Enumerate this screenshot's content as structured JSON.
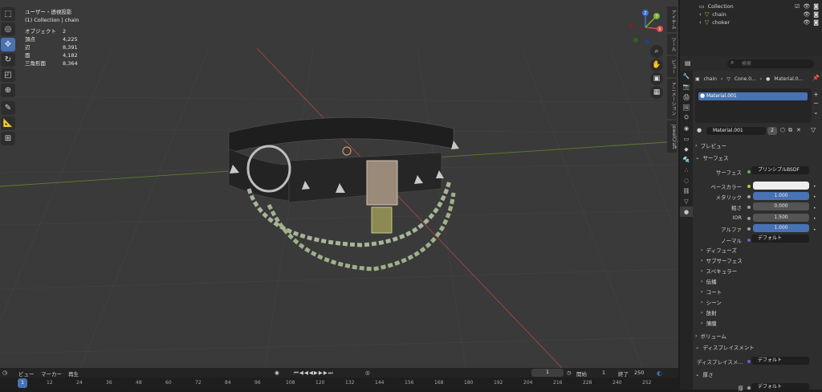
{
  "viewport": {
    "stats_header": "ユーザー・透視投影",
    "stats_sub": "(1) Collection | chain",
    "stats": [
      {
        "label": "オブジェクト",
        "value": "2"
      },
      {
        "label": "頂点",
        "value": "4,225"
      },
      {
        "label": "辺",
        "value": "8,391"
      },
      {
        "label": "面",
        "value": "4,182"
      },
      {
        "label": "三角形面",
        "value": "8,364"
      }
    ],
    "gizmo_axes": {
      "x": "X",
      "y": "Y",
      "z": "Z"
    },
    "side_tabs": [
      "アイテム",
      "ツール",
      "ビュー",
      "アニメーション",
      "JewelCraft"
    ]
  },
  "outliner": {
    "collection": "Collection",
    "items": [
      "chain",
      "choker"
    ]
  },
  "properties": {
    "search_placeholder": "検索",
    "breadcrumb": [
      "chain",
      "Cone.0...",
      "Material.0..."
    ],
    "slot": "Material.001",
    "material_name": "Material.001",
    "material_users": "2",
    "sections": {
      "preview": "プレビュー",
      "surface": "サーフェス",
      "volume": "ボリューム",
      "displacement": "ディスプレイスメント",
      "thickness": "厚さ"
    },
    "surface_label": "サーフェス",
    "surface_value": "プリンシプルBSDF",
    "fields": [
      {
        "label": "ベースカラー",
        "value": ""
      },
      {
        "label": "メタリック",
        "value": "1.000"
      },
      {
        "label": "粗さ",
        "value": "0.000"
      },
      {
        "label": "IOR",
        "value": "1.500"
      },
      {
        "label": "アルファ",
        "value": "1.000"
      },
      {
        "label": "ノーマル",
        "value": "デフォルト"
      }
    ],
    "subsections": [
      "ディフューズ",
      "サブサーフェス",
      "スペキュラー",
      "伝播",
      "コート",
      "シーン",
      "放射",
      "薄膜"
    ],
    "displacement_label": "ディスプレイスメ...",
    "displacement_value": "デフォルト",
    "thickness_value": "デフォルト",
    "thickness_label": "厚"
  },
  "timeline": {
    "menus": [
      "ビュー",
      "マーカー",
      "再生"
    ],
    "current_frame": "1",
    "start_label": "開始",
    "start_value": "1",
    "end_label": "終了",
    "end_value": "250",
    "ruler_frame": "1",
    "ticks": [
      "12",
      "24",
      "36",
      "48",
      "60",
      "72",
      "84",
      "96",
      "108",
      "120",
      "132",
      "144",
      "156",
      "168",
      "180",
      "192",
      "204",
      "216",
      "228",
      "240",
      "252"
    ]
  },
  "colors": {
    "accent": "#4772b3",
    "viewport_bg": "#3a3a3a",
    "x_axis": "#d94c4c",
    "y_axis": "#7ab23a"
  }
}
